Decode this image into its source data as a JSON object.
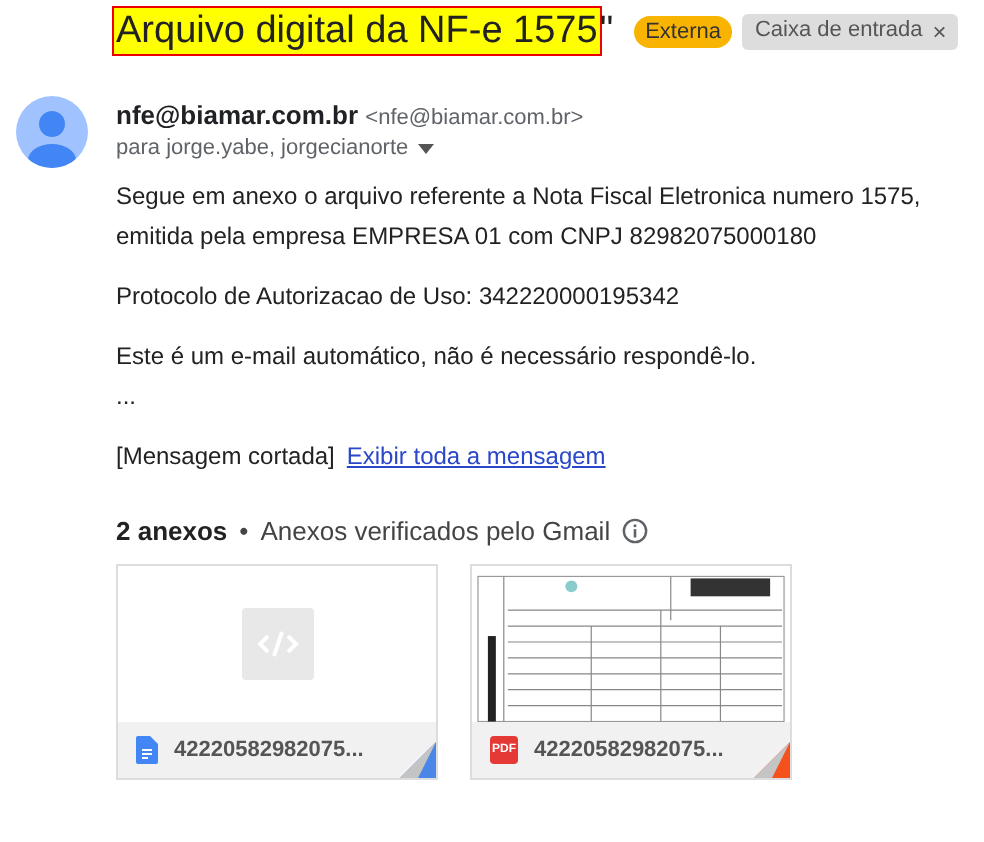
{
  "subject": {
    "highlighted": "Arquivo digital da NF-e 1575",
    "rest": "\""
  },
  "labels": [
    {
      "kind": "external",
      "text": "Externa"
    },
    {
      "kind": "inbox",
      "text": "Caixa de entrada",
      "close": "×"
    }
  ],
  "sender": {
    "name": "nfe@biamar.com.br",
    "address": "<nfe@biamar.com.br>",
    "recipients": "para jorge.yabe, jorgecianorte"
  },
  "body": [
    "Segue em anexo o arquivo referente a Nota Fiscal Eletronica numero 1575, emitida pela empresa EMPRESA 01 com CNPJ 82982075000180",
    "Protocolo de Autorizacao de Uso: 342220000195342",
    "Este é um e-mail automático, não é necessário respondê-lo.\n..."
  ],
  "truncated": {
    "note": "[Mensagem cortada]",
    "link": "Exibir toda a mensagem"
  },
  "attachments": {
    "count": "2 anexos",
    "separator": "•",
    "verified": "Anexos verificados pelo Gmail",
    "items": [
      {
        "kind": "xml",
        "name": "42220582982075...",
        "color": "#4a86e8"
      },
      {
        "kind": "pdf",
        "name": "42220582982075...",
        "icon_label": "PDF",
        "color": "#f4511e"
      }
    ]
  }
}
